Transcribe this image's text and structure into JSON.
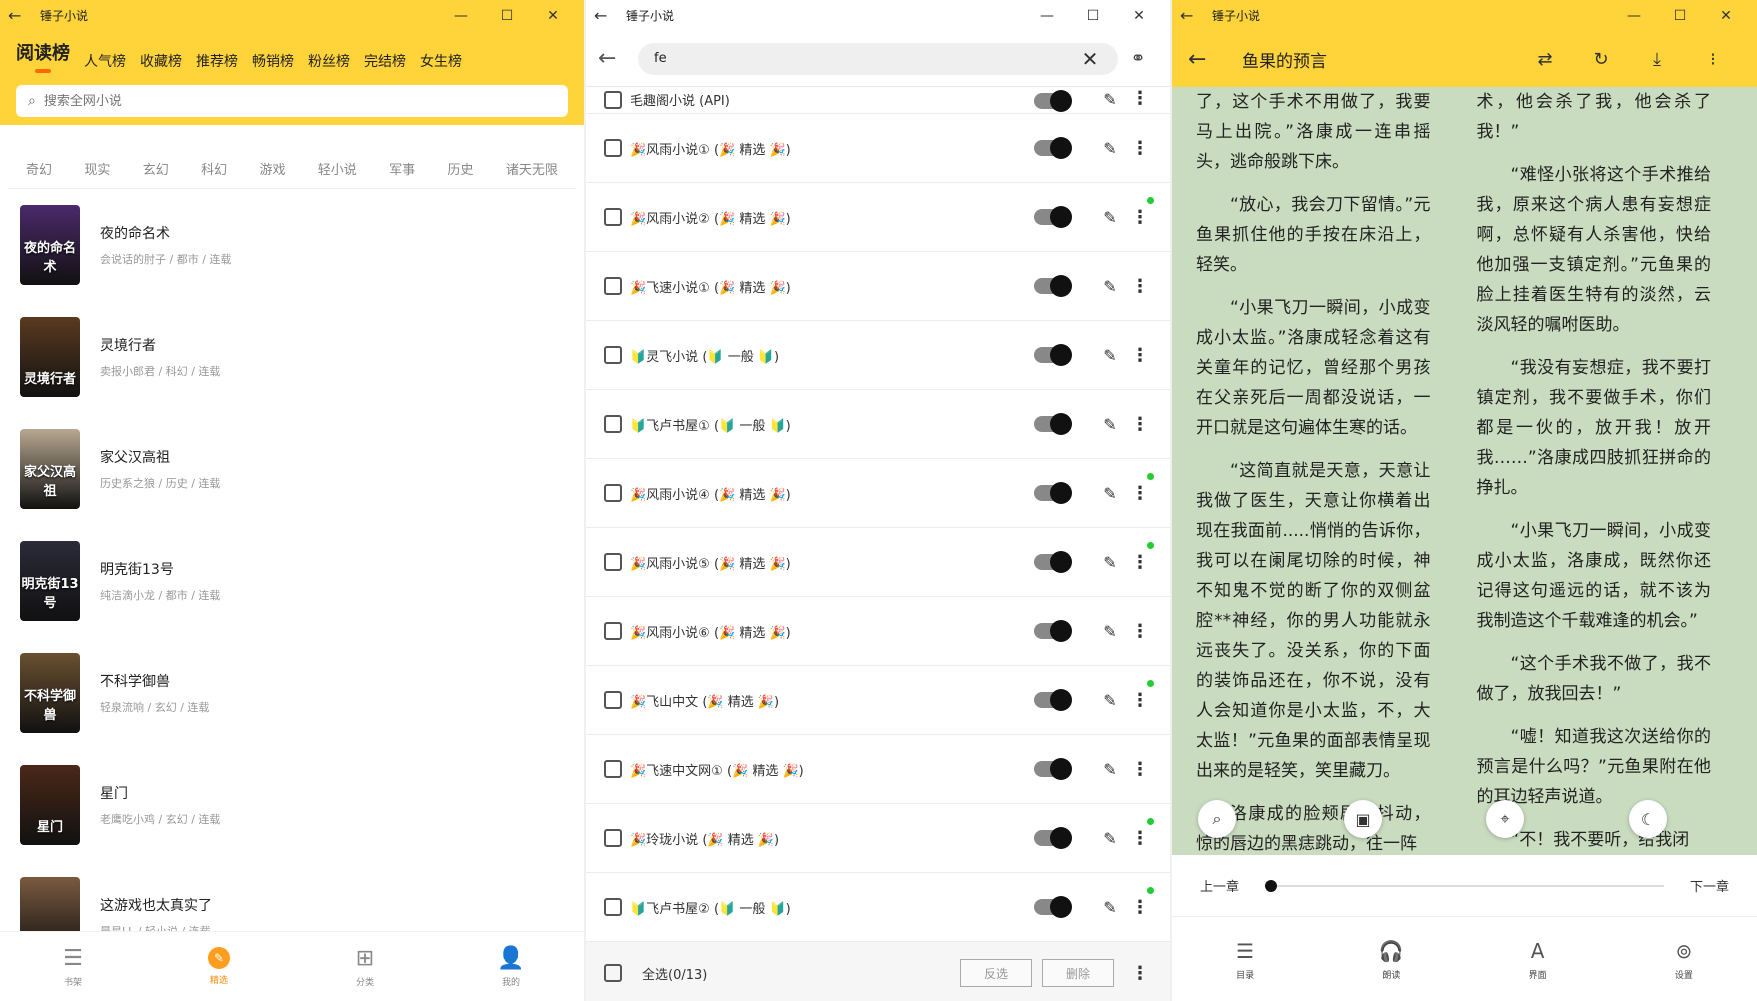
{
  "app_name": "锤子小说",
  "window1": {
    "rank_tabs": [
      "阅读榜",
      "人气榜",
      "收藏榜",
      "推荐榜",
      "畅销榜",
      "粉丝榜",
      "完结榜",
      "女生榜"
    ],
    "search_placeholder": "搜索全网小说",
    "categories": [
      "奇幻",
      "现实",
      "玄幻",
      "科幻",
      "游戏",
      "轻小说",
      "军事",
      "历史",
      "诸天无限"
    ],
    "books": [
      {
        "name": "夜的命名术",
        "meta": "会说话的肘子 / 都市 / 连载",
        "cover_text": "夜的命名术",
        "cover_color": "#4a2a6a"
      },
      {
        "name": "灵境行者",
        "meta": "卖报小郎君 / 科幻 / 连载",
        "cover_text": "灵境行者",
        "cover_color": "#5a3a20"
      },
      {
        "name": "家父汉高祖",
        "meta": "历史系之狼 / 历史 / 连载",
        "cover_text": "家父汉高祖",
        "cover_color": "#b8a890"
      },
      {
        "name": "明克街13号",
        "meta": "纯洁滴小龙 / 都市 / 连载",
        "cover_text": "明克街13号",
        "cover_color": "#2a2a3a"
      },
      {
        "name": "不科学御兽",
        "meta": "轻泉流响 / 玄幻 / 连载",
        "cover_text": "不科学御兽",
        "cover_color": "#6a5030"
      },
      {
        "name": "星门",
        "meta": "老鹰吃小鸡 / 玄幻 / 连载",
        "cover_text": "星门",
        "cover_color": "#4a2818"
      },
      {
        "name": "这游戏也太真实了",
        "meta": "晨星LL / 轻小说 / 连载",
        "cover_text": "",
        "cover_color": "#7a5a40"
      }
    ],
    "nav": [
      "书架",
      "精选",
      "分类",
      "我的"
    ]
  },
  "window2": {
    "search_value": "fe",
    "partial_source": "毛趣阁小说 (API)",
    "sources": [
      {
        "icon": "🎉",
        "name": "风雨小说①",
        "tag": "精选",
        "dot": false
      },
      {
        "icon": "🎉",
        "name": "风雨小说②",
        "tag": "精选",
        "dot": true
      },
      {
        "icon": "🎉",
        "name": "飞速小说①",
        "tag": "精选",
        "dot": false
      },
      {
        "icon": "🔰",
        "name": "灵飞小说",
        "tag": "一般",
        "dot": false
      },
      {
        "icon": "🔰",
        "name": "飞卢书屋①",
        "tag": "一般",
        "dot": false
      },
      {
        "icon": "🎉",
        "name": "风雨小说④",
        "tag": "精选",
        "dot": true
      },
      {
        "icon": "🎉",
        "name": "风雨小说⑤",
        "tag": "精选",
        "dot": true
      },
      {
        "icon": "🎉",
        "name": "风雨小说⑥",
        "tag": "精选",
        "dot": false
      },
      {
        "icon": "🎉",
        "name": "飞山中文",
        "tag": "精选",
        "dot": true
      },
      {
        "icon": "🎉",
        "name": "飞速中文网①",
        "tag": "精选",
        "dot": false
      },
      {
        "icon": "🎉",
        "name": "玲珑小说",
        "tag": "精选",
        "dot": true
      },
      {
        "icon": "🔰",
        "name": "飞卢书屋②",
        "tag": "一般",
        "dot": true
      }
    ],
    "select_all": "全选(0/13)",
    "invert": "反选",
    "delete": "删除"
  },
  "window3": {
    "book_title": "鱼果的预言",
    "col1": [
      {
        "t": "了，这个手术不用做了，我要马上出院。”洛康成一连串摇头，逃命般跳下床。",
        "ind": false
      },
      {
        "t": "“放心，我会刀下留情。”元鱼果抓住他的手按在床沿上，轻笑。",
        "ind": true
      },
      {
        "t": "“小果飞刀一瞬间，小成变成小太监。”洛康成轻念着这有关童年的记忆，曾经那个男孩在父亲死后一周都没说话，一开口就是这句遍体生寒的话。",
        "ind": true
      },
      {
        "t": "“这简直就是天意，天意让我做了医生，天意让你横着出现在我面前.....悄悄的告诉你，我可以在阑尾切除的时候，神不知鬼不觉的断了你的双侧盆腔**神经，你的男人功能就永远丧失了。没关系，你的下面的装饰品还在，你不说，没有人会知道你是小太监，不，大太监！”元鱼果的面部表情呈现出来的是轻笑，笑里藏刀。",
        "ind": true
      },
      {
        "t": "洛康成的脸颊剧烈抖动，惊的唇边的黑痣跳动，往一阵",
        "ind": true
      }
    ],
    "col2": [
      {
        "t": "术，他会杀了我，他会杀了我！”",
        "ind": false
      },
      {
        "t": "“难怪小张将这个手术推给我，原来这个病人患有妄想症啊，总怀疑有人杀害他，快给他加强一支镇定剂。”元鱼果的脸上挂着医生特有的淡然，云淡风轻的嘱咐医助。",
        "ind": true
      },
      {
        "t": "“我没有妄想症，我不要打镇定剂，我不要做手术，你们都是一伙的，放开我！放开我……”洛康成四肢抓狂拼命的挣扎。",
        "ind": true
      },
      {
        "t": "“小果飞刀一瞬间，小成变成小太监，洛康成，既然你还记得这句遥远的话，就不该为我制造这个千载难逢的机会。”",
        "ind": true
      },
      {
        "t": "“这个手术我不做了，我不做了，放我回去！”",
        "ind": true
      },
      {
        "t": "“嘘！知道我这次送给你的预言是什么吗？”元鱼果附在他的耳边轻声说道。",
        "ind": true
      },
      {
        "t": "“不！我不要听，给我闭",
        "ind": true
      }
    ],
    "prev_chapter": "上一章",
    "next_chapter": "下一章",
    "progress": 0,
    "nav": [
      "目录",
      "朗读",
      "界面",
      "设置"
    ]
  }
}
